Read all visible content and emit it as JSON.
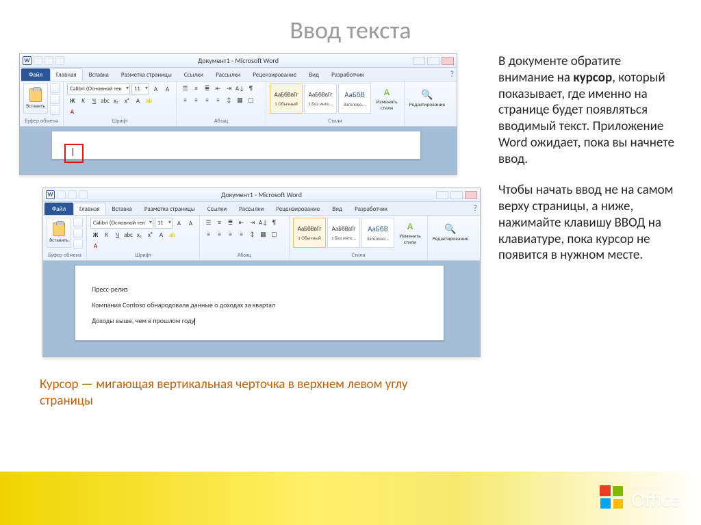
{
  "slide": {
    "title": "Ввод текста",
    "caption": "Курсор — мигающая вертикальная черточка в верхнем левом углу страницы"
  },
  "body": {
    "p1_pre": "В документе обратите внимание на ",
    "p1_bold": "курсор",
    "p1_post": ", который показывает, где именно на странице будет появляться вводимый текст. Приложение Word ожидает, пока вы начнете ввод.",
    "p2": "Чтобы начать ввод не на самом верху страницы, а ниже, нажимайте клавишу ВВОД на клавиатуре, пока курсор не появится в нужном месте."
  },
  "word": {
    "title": "Документ1 - Microsoft Word",
    "tabs": {
      "file": "Файл",
      "home": "Главная",
      "insert": "Вставка",
      "layout": "Разметка страницы",
      "refs": "Ссылки",
      "mail": "Рассылки",
      "review": "Рецензирование",
      "view": "Вид",
      "dev": "Разработчик"
    },
    "groups": {
      "clipboard": "Буфер обмена",
      "font": "Шрифт",
      "paragraph": "Абзац",
      "styles": "Стили"
    },
    "paste": "Вставить",
    "font_name": "Calibri (Основной тек",
    "font_size": "11",
    "styles_gallery": {
      "sample": "АаБбВвГг",
      "sample_big": "АаБбВ",
      "normal": "1 Обычный",
      "nospace": "1 Без инте...",
      "heading": "Заголово..."
    },
    "change_styles": "Изменить стили",
    "editing": "Редактирование"
  },
  "doc2": {
    "line1": "Пресс-релиз",
    "line2": "Компания Contoso обнародовала данные о доходах за квартал",
    "line3": "Доходы выше, чем в прошлом году"
  },
  "logo": {
    "ms": "Microsoft®",
    "office": "Office"
  }
}
